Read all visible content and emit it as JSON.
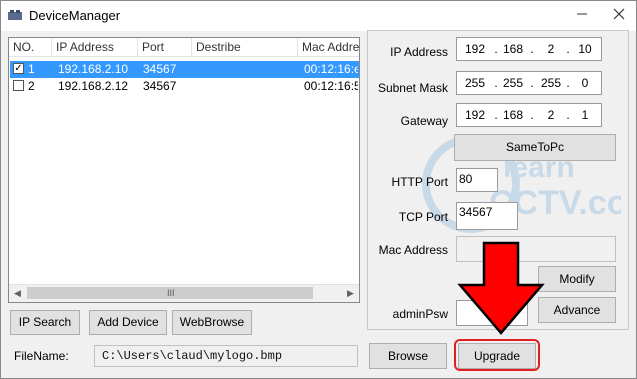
{
  "window": {
    "title": "DeviceManager",
    "minimize_icon": "minimize-icon",
    "close_icon": "close-icon"
  },
  "device_list": {
    "columns": [
      "NO.",
      "IP Address",
      "Port",
      "Destribe",
      "Mac Addre"
    ],
    "rows": [
      {
        "checked": true,
        "no": "1",
        "ip": "192.168.2.10",
        "port": "34567",
        "describe": "",
        "mac": "00:12:16:e",
        "selected": true
      },
      {
        "checked": false,
        "no": "2",
        "ip": "192.168.2.12",
        "port": "34567",
        "describe": "",
        "mac": "00:12:16:5",
        "selected": false
      }
    ],
    "scroll_grip": "III"
  },
  "buttons": {
    "ip_search": "IP Search",
    "add_device": "Add Device",
    "web_browse": "WebBrowse",
    "same_to_pc": "SameToPc",
    "modify": "Modify",
    "advance": "Advance",
    "browse": "Browse",
    "upgrade": "Upgrade"
  },
  "settings": {
    "ip_address_label": "IP Address",
    "ip_address": [
      "192",
      "168",
      "2",
      "10"
    ],
    "subnet_mask_label": "Subnet Mask",
    "subnet_mask": [
      "255",
      "255",
      "255",
      "0"
    ],
    "gateway_label": "Gateway",
    "gateway": [
      "192",
      "168",
      "2",
      "1"
    ],
    "http_port_label": "HTTP Port",
    "http_port": "80",
    "tcp_port_label": "TCP Port",
    "tcp_port": "34567",
    "mac_address_label": "Mac Address",
    "mac_address": "",
    "admin_psw_label": "adminPsw",
    "admin_psw": ""
  },
  "file": {
    "label": "FileName:",
    "value": "C:\\Users\\claud\\mylogo.bmp"
  },
  "overlay": {
    "arrow_color": "#ff0000",
    "highlight_color": "#e02020",
    "watermark_color": "#1a73c8"
  }
}
